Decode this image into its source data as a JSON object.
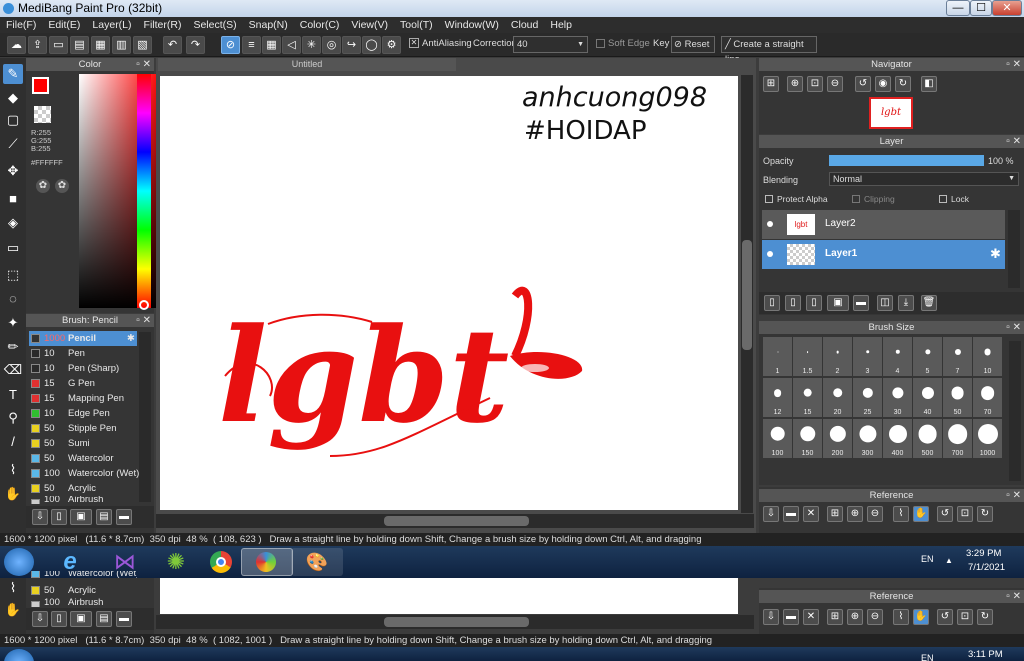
{
  "window": {
    "title": "MediBang Paint Pro (32bit)",
    "min": "—",
    "max": "☐",
    "close": "✕"
  },
  "menu": [
    "File(F)",
    "Edit(E)",
    "Layer(L)",
    "Filter(R)",
    "Select(S)",
    "Snap(N)",
    "Color(C)",
    "View(V)",
    "Tool(T)",
    "Window(W)",
    "Cloud",
    "Help"
  ],
  "toolbar": {
    "antialias_label": "AntiAliasing",
    "correction_label": "Correction",
    "correction_value": "40",
    "soft_edge_label": "Soft Edge",
    "key_label": "Key",
    "reset_label": "Reset",
    "straight_line_label": "Create a straight line"
  },
  "color_panel": {
    "title": "Color",
    "r": "R:255",
    "g": "G:255",
    "b": "B:255",
    "hex": "#FFFFFF",
    "fg": "#ff0000",
    "bg": "#ffffff"
  },
  "brush_panel": {
    "title": "Brush: Pencil",
    "items": [
      {
        "size": "1000",
        "name": "Pencil",
        "color": "#3a3a3a"
      },
      {
        "size": "10",
        "name": "Pen",
        "color": "#2a2a2a"
      },
      {
        "size": "10",
        "name": "Pen (Sharp)",
        "color": "#2a2a2a"
      },
      {
        "size": "15",
        "name": "G Pen",
        "color": "#e03030"
      },
      {
        "size": "15",
        "name": "Mapping Pen",
        "color": "#e03030"
      },
      {
        "size": "10",
        "name": "Edge Pen",
        "color": "#2fbf2f"
      },
      {
        "size": "50",
        "name": "Stipple Pen",
        "color": "#e8d020"
      },
      {
        "size": "50",
        "name": "Sumi",
        "color": "#e8d020"
      },
      {
        "size": "50",
        "name": "Watercolor",
        "color": "#5ab8e8"
      },
      {
        "size": "100",
        "name": "Watercolor (Wet)",
        "color": "#5ab8e8"
      },
      {
        "size": "50",
        "name": "Acrylic",
        "color": "#e8d020"
      },
      {
        "size": "100",
        "name": "Airbrush",
        "color": "#cccccc"
      }
    ]
  },
  "canvas": {
    "tab_title": "Untitled",
    "watermark_line1": "anhcuong098",
    "watermark_line2": "#HOIDAP",
    "artwork_text": "lgbt"
  },
  "navigator": {
    "title": "Navigator",
    "thumb_text": "lgbt"
  },
  "layer_panel": {
    "title": "Layer",
    "opacity_label": "Opacity",
    "opacity_value": "100 %",
    "opacity_fraction": 1.0,
    "blending_label": "Blending",
    "blending_value": "Normal",
    "protect_alpha": "Protect Alpha",
    "clipping": "Clipping",
    "lock": "Lock",
    "layers": [
      {
        "name": "Layer2",
        "selected": false
      },
      {
        "name": "Layer1",
        "selected": true
      }
    ]
  },
  "brush_size": {
    "title": "Brush Size",
    "sizes": [
      "1",
      "1.5",
      "2",
      "3",
      "4",
      "5",
      "7",
      "10",
      "12",
      "15",
      "20",
      "25",
      "30",
      "40",
      "50",
      "70",
      "100",
      "150",
      "200",
      "300",
      "400",
      "500",
      "700",
      "1000"
    ]
  },
  "reference": {
    "title": "Reference"
  },
  "status": {
    "top": {
      "dims": "1600 * 1200 pixel",
      "cm": "(11.6 * 8.7cm)",
      "dpi": "350 dpi",
      "zoom": "48 %",
      "coords": "( 108, 623 )",
      "hint": "Draw a straight line by holding down Shift, Change a brush size by holding down Ctrl, Alt, and dragging"
    },
    "bottom": {
      "dims": "1600 * 1200 pixel",
      "cm": "(11.6 * 8.7cm)",
      "dpi": "350 dpi",
      "zoom": "48 %",
      "coords": "( 1082, 1001 )",
      "hint": "Draw a straight line by holding down Shift, Change a brush size by holding down Ctrl, Alt, and dragging"
    }
  },
  "taskbar": {
    "lang": "EN",
    "time": "3:29 PM",
    "date": "7/1/2021",
    "lang2": "EN",
    "time2": "3:11 PM"
  },
  "dup_brushes": [
    {
      "size": "100",
      "name": "Watercolor (Wet)",
      "color": "#5ab8e8"
    },
    {
      "size": "50",
      "name": "Acrylic",
      "color": "#e8d020"
    },
    {
      "size": "100",
      "name": "Airbrush",
      "color": "#cccccc"
    }
  ]
}
